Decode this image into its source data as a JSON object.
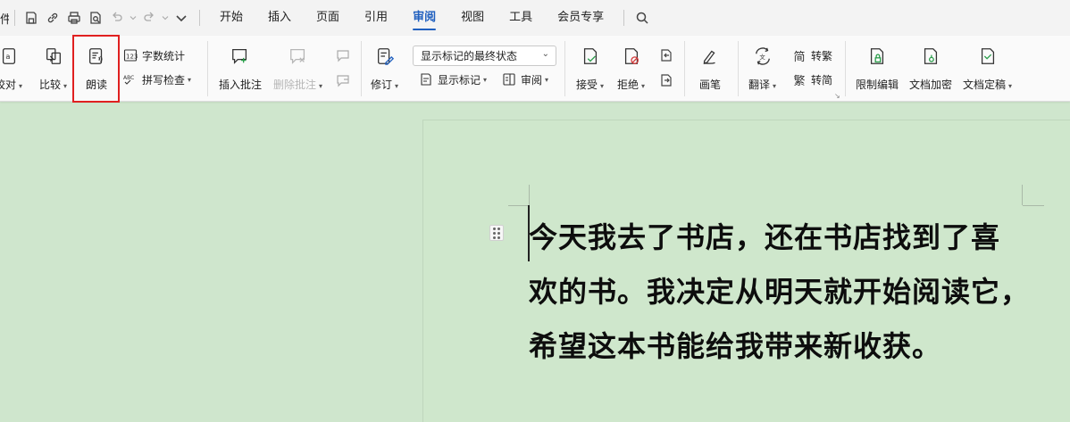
{
  "menubar": {
    "truncated_left": "件",
    "tabs": [
      {
        "label": "开始"
      },
      {
        "label": "插入"
      },
      {
        "label": "页面"
      },
      {
        "label": "引用"
      },
      {
        "label": "审阅",
        "active": true
      },
      {
        "label": "视图"
      },
      {
        "label": "工具"
      },
      {
        "label": "会员专享"
      }
    ]
  },
  "ribbon": {
    "proofread": "校对",
    "compare": "比较",
    "read_aloud": "朗读",
    "word_count": "字数统计",
    "spell_check": "拼写检查",
    "insert_comment": "插入批注",
    "delete_comment": "删除批注",
    "revise": "修订",
    "markup_state": "显示标记的最终状态",
    "show_markup": "显示标记",
    "review_pane": "审阅",
    "accept": "接受",
    "reject": "拒绝",
    "ink": "画笔",
    "translate": "翻译",
    "to_traditional": "转繁",
    "to_simplified": "转简",
    "restrict_edit": "限制编辑",
    "encrypt_doc": "文档加密",
    "finalize_doc": "文档定稿",
    "accent_color": "#1f5fbf",
    "highlight_color": "#e02020"
  },
  "document": {
    "lines": [
      "今天我去了书店，还在书店找到了喜",
      "欢的书。我决定从明天就开始阅读它，",
      "希望这本书能给我带来新收获。"
    ],
    "background": "#cfe6cd"
  }
}
